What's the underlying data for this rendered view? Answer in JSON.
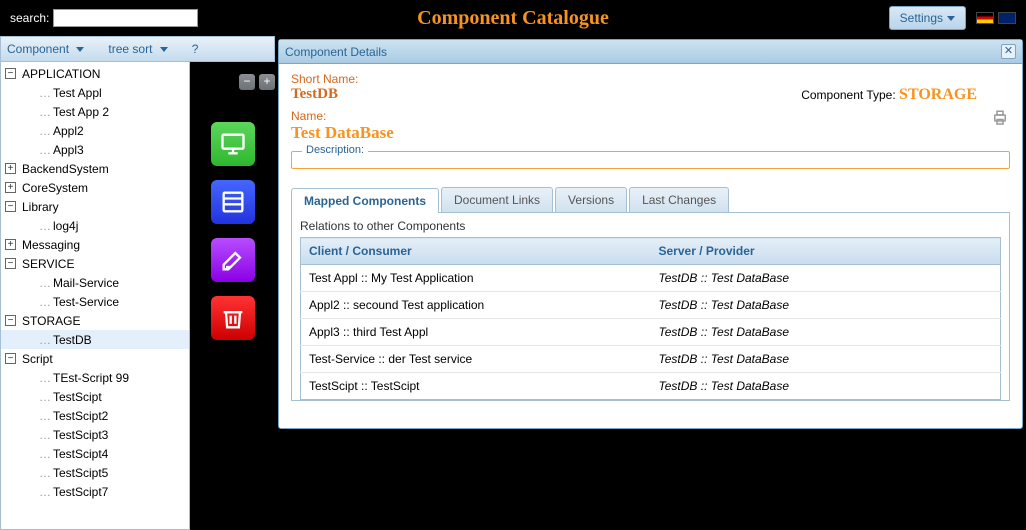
{
  "header": {
    "search_label": "search:",
    "search_value": "",
    "title": "Component Catalogue",
    "settings_label": "Settings"
  },
  "toolbar": {
    "component_label": "Component",
    "tree_sort_label": "tree sort",
    "help_label": "?"
  },
  "tree": [
    {
      "type": "cat",
      "label": "APPLICATION",
      "expanded": true,
      "children": [
        {
          "label": "Test Appl"
        },
        {
          "label": "Test App 2"
        },
        {
          "label": "Appl2"
        },
        {
          "label": "Appl3"
        }
      ]
    },
    {
      "type": "cat",
      "label": "BackendSystem",
      "expanded": false
    },
    {
      "type": "cat",
      "label": "CoreSystem",
      "expanded": false
    },
    {
      "type": "cat",
      "label": "Library",
      "expanded": true,
      "children": [
        {
          "label": "log4j"
        }
      ]
    },
    {
      "type": "cat",
      "label": "Messaging",
      "expanded": false
    },
    {
      "type": "cat",
      "label": "SERVICE",
      "expanded": true,
      "children": [
        {
          "label": "Mail-Service"
        },
        {
          "label": "Test-Service"
        }
      ]
    },
    {
      "type": "cat",
      "label": "STORAGE",
      "expanded": true,
      "children": [
        {
          "label": "TestDB",
          "selected": true
        }
      ]
    },
    {
      "type": "cat",
      "label": "Script",
      "expanded": true,
      "children": [
        {
          "label": "TEst-Script 99"
        },
        {
          "label": "TestScipt"
        },
        {
          "label": "TestScipt2"
        },
        {
          "label": "TestScipt3"
        },
        {
          "label": "TestScipt4"
        },
        {
          "label": "TestScipt5"
        },
        {
          "label": "TestScipt7"
        }
      ]
    }
  ],
  "details": {
    "panel_title": "Component Details",
    "short_name_label": "Short Name:",
    "short_name_value": "TestDB",
    "component_type_label": "Component Type:",
    "component_type_value": "STORAGE",
    "name_label": "Name:",
    "name_value": "Test DataBase",
    "description_label": "Description:"
  },
  "tabs": {
    "mapped": "Mapped Components",
    "docs": "Document Links",
    "versions": "Versions",
    "changes": "Last Changes"
  },
  "relations": {
    "title": "Relations to other Components",
    "col_client": "Client / Consumer",
    "col_server": "Server / Provider",
    "rows": [
      {
        "client": "Test Appl :: My Test Application",
        "server": "TestDB :: Test DataBase"
      },
      {
        "client": "Appl2 :: secound Test application",
        "server": "TestDB :: Test DataBase"
      },
      {
        "client": "Appl3 :: third Test Appl",
        "server": "TestDB :: Test DataBase"
      },
      {
        "client": "Test-Service :: der Test service",
        "server": "TestDB :: Test DataBase"
      },
      {
        "client": "TestScipt :: TestScipt",
        "server": "TestDB :: Test DataBase"
      }
    ]
  }
}
